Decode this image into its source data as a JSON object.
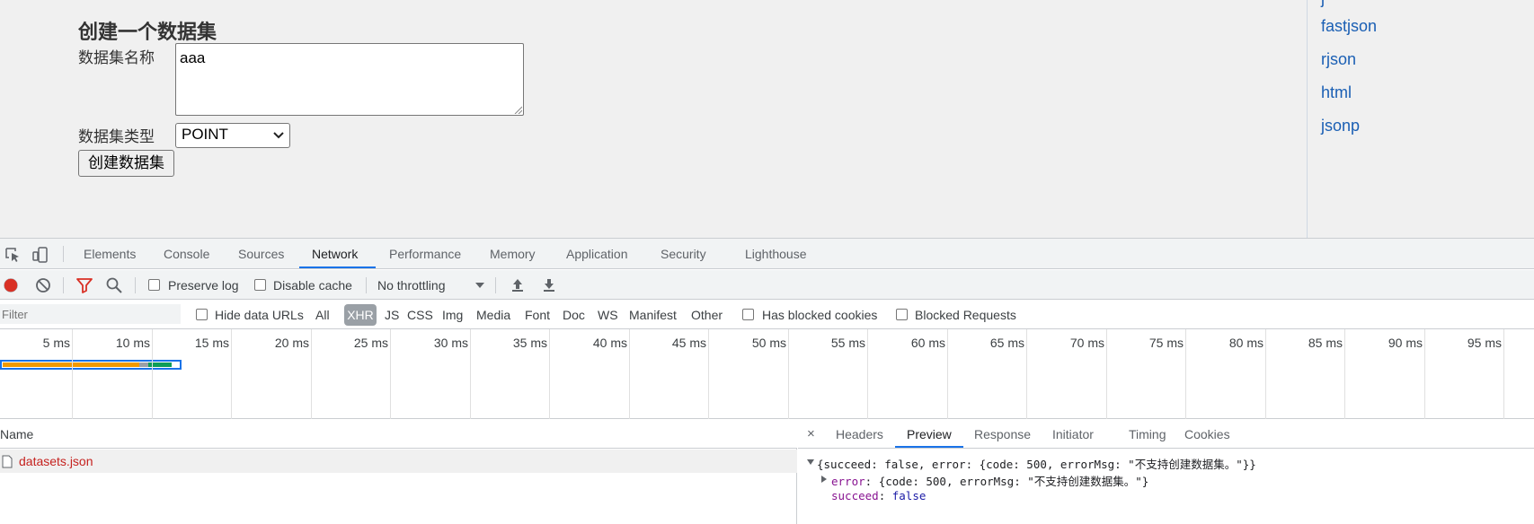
{
  "page": {
    "form_title": "创建一个数据集",
    "name_label": "数据集名称",
    "name_value": "aaa",
    "type_label": "数据集类型",
    "type_value": "POINT",
    "create_button": "创建数据集",
    "links": [
      "fastjson",
      "rjson",
      "html",
      "jsonp"
    ]
  },
  "devtools": {
    "tabs": [
      "Elements",
      "Console",
      "Sources",
      "Network",
      "Performance",
      "Memory",
      "Application",
      "Security",
      "Lighthouse"
    ],
    "active_tab": "Network",
    "toolbar": {
      "preserve_log": "Preserve log",
      "disable_cache": "Disable cache",
      "throttling": "No throttling"
    },
    "filter": {
      "placeholder": "Filter",
      "hide_data_urls": "Hide data URLs",
      "types": [
        "All",
        "XHR",
        "JS",
        "CSS",
        "Img",
        "Media",
        "Font",
        "Doc",
        "WS",
        "Manifest",
        "Other"
      ],
      "active_type": "XHR",
      "has_blocked_cookies": "Has blocked cookies",
      "blocked_requests": "Blocked Requests"
    },
    "timeline_ticks": [
      "5 ms",
      "10 ms",
      "15 ms",
      "20 ms",
      "25 ms",
      "30 ms",
      "35 ms",
      "40 ms",
      "45 ms",
      "50 ms",
      "55 ms",
      "60 ms",
      "65 ms",
      "70 ms",
      "75 ms",
      "80 ms",
      "85 ms",
      "90 ms",
      "95 ms"
    ],
    "requests": {
      "header": "Name",
      "rows": [
        "datasets.json"
      ]
    },
    "detail": {
      "close": "×",
      "tabs": [
        "Headers",
        "Preview",
        "Response",
        "Initiator",
        "Timing",
        "Cookies"
      ],
      "active_tab": "Preview",
      "preview": {
        "line1": "{succeed: false, error: {code: 500, errorMsg: \"不支持创建数据集。\"}}",
        "line2_key": "error",
        "line2_val": ": {code: 500, errorMsg: \"不支持创建数据集。\"}",
        "line3_key": "succeed",
        "line3_val": "false"
      }
    }
  },
  "colors": {
    "accent": "#1a73e8",
    "record": "#d93025",
    "request_name": "#c5221f",
    "link": "#1a5fb4"
  }
}
